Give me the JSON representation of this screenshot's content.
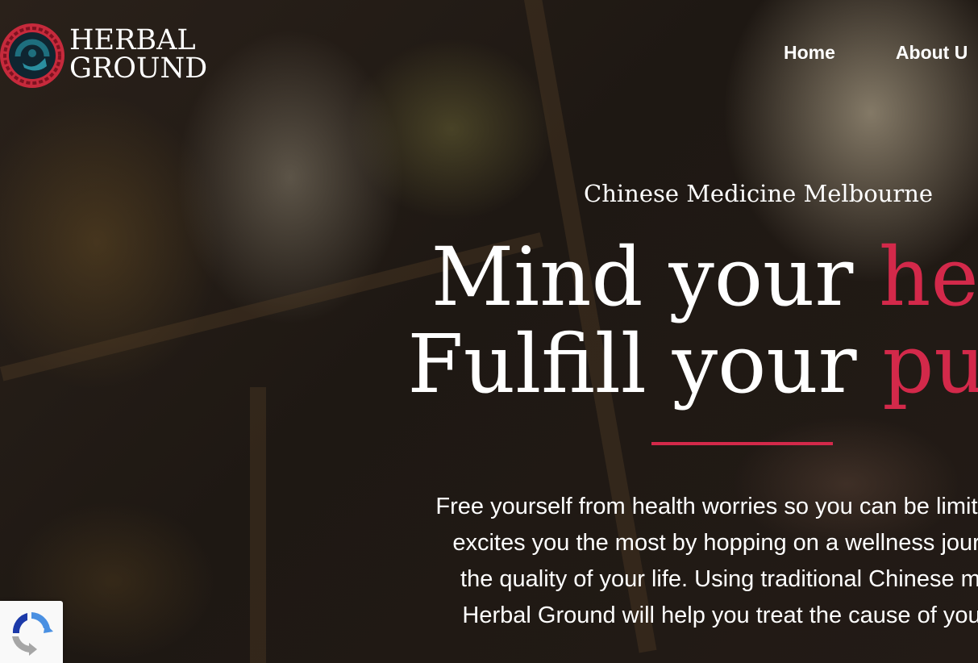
{
  "brand": {
    "line1": "HERBAL",
    "line2": "GROUND"
  },
  "nav": {
    "items": [
      {
        "label": "Home"
      },
      {
        "label": "About U"
      }
    ]
  },
  "hero": {
    "subtitle": "Chinese Medicine Melbourne",
    "line1_plain": "Mind your ",
    "line1_accent": "heal",
    "line2_plain": "Fulfill your ",
    "line2_accent": "purp",
    "body": [
      "Free yourself from health worries so you can be limitless. E",
      "excites you the most by hopping on a wellness journey t",
      "the quality of your life. Using traditional Chinese medic",
      "Herbal Ground will help you treat the cause of your he"
    ]
  },
  "colors": {
    "accent": "#d3294a",
    "text": "#ffffff",
    "logo_teal": "#1e6f7e",
    "logo_navy": "#123a4c"
  },
  "icons": {
    "logo": "herbal-ground-logo-icon",
    "recaptcha": "recaptcha-icon"
  }
}
